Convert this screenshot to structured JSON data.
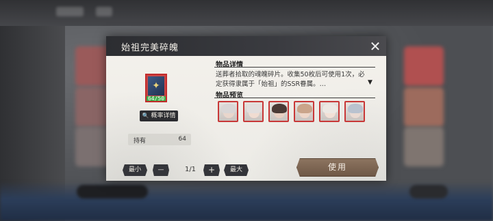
{
  "modal": {
    "title": "始祖完美碎魄",
    "item": {
      "count_text": "64/50",
      "count_progress": 1.0,
      "icon": "crest-icon"
    },
    "odds_button_label": "概率详情",
    "own_label": "持有",
    "own_value": "64",
    "details_title": "物品详情",
    "description": "送葬者拾取的魂魄碎片。收集50枚后可使用1次，必定获得隶属于「始祖」的SSR眷属。…",
    "preview_title": "物品预览",
    "preview_characters": [
      {
        "name": "char-1",
        "hair": "#d9d6d6",
        "skin": "#e9d6cc"
      },
      {
        "name": "char-2",
        "hair": "#e2dedd",
        "skin": "#f0dcd1"
      },
      {
        "name": "char-3",
        "hair": "#4a3a36",
        "skin": "#e8cfc2"
      },
      {
        "name": "char-4",
        "hair": "#caa48a",
        "skin": "#eed6c8"
      },
      {
        "name": "char-5",
        "hair": "#ece8e3",
        "skin": "#f2e0d6"
      },
      {
        "name": "char-6",
        "hair": "#b9c2cf",
        "skin": "#eadad2"
      }
    ],
    "min_label": "最小",
    "minus_label": "—",
    "quantity": "1/1",
    "plus_label": "+",
    "max_label": "最大",
    "use_label": "使用"
  },
  "colors": {
    "rarity_border": "#c83737",
    "header_bg": "#2c2d31",
    "use_button": "#7d6553"
  }
}
